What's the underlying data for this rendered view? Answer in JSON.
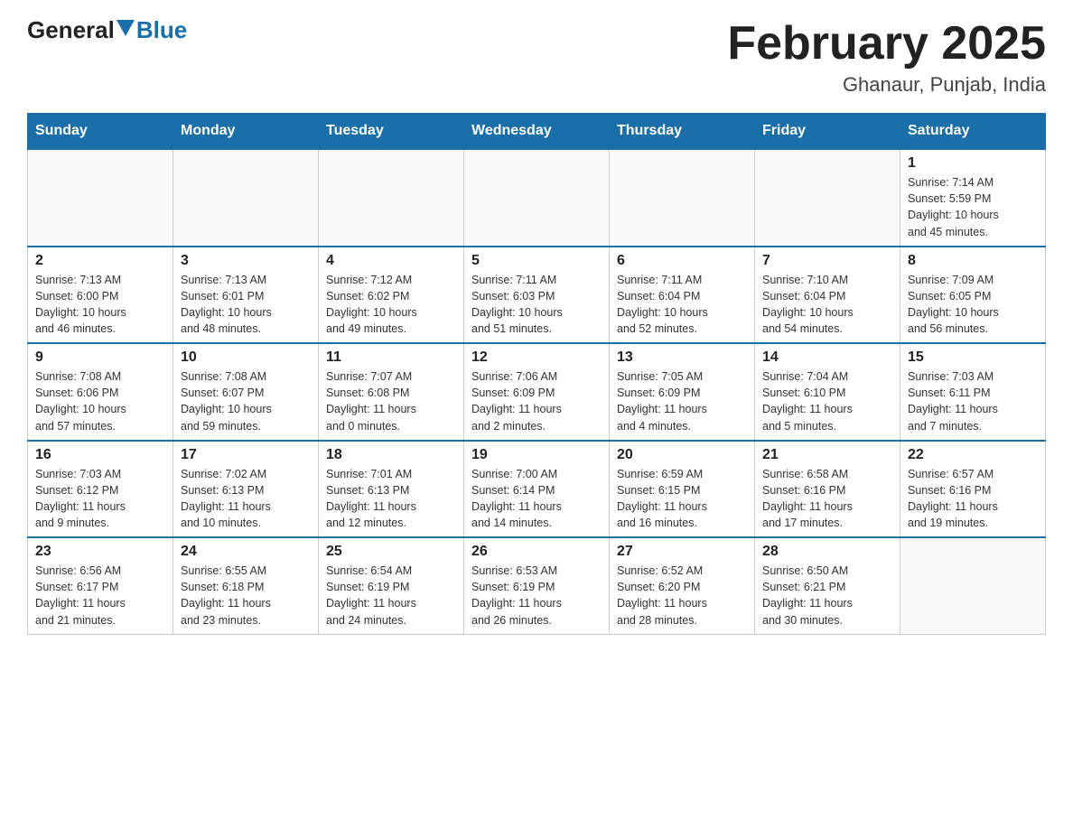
{
  "header": {
    "logo_general": "General",
    "logo_blue": "Blue",
    "month_title": "February 2025",
    "location": "Ghanaur, Punjab, India"
  },
  "days_of_week": [
    "Sunday",
    "Monday",
    "Tuesday",
    "Wednesday",
    "Thursday",
    "Friday",
    "Saturday"
  ],
  "weeks": [
    [
      {
        "day": "",
        "info": ""
      },
      {
        "day": "",
        "info": ""
      },
      {
        "day": "",
        "info": ""
      },
      {
        "day": "",
        "info": ""
      },
      {
        "day": "",
        "info": ""
      },
      {
        "day": "",
        "info": ""
      },
      {
        "day": "1",
        "info": "Sunrise: 7:14 AM\nSunset: 5:59 PM\nDaylight: 10 hours\nand 45 minutes."
      }
    ],
    [
      {
        "day": "2",
        "info": "Sunrise: 7:13 AM\nSunset: 6:00 PM\nDaylight: 10 hours\nand 46 minutes."
      },
      {
        "day": "3",
        "info": "Sunrise: 7:13 AM\nSunset: 6:01 PM\nDaylight: 10 hours\nand 48 minutes."
      },
      {
        "day": "4",
        "info": "Sunrise: 7:12 AM\nSunset: 6:02 PM\nDaylight: 10 hours\nand 49 minutes."
      },
      {
        "day": "5",
        "info": "Sunrise: 7:11 AM\nSunset: 6:03 PM\nDaylight: 10 hours\nand 51 minutes."
      },
      {
        "day": "6",
        "info": "Sunrise: 7:11 AM\nSunset: 6:04 PM\nDaylight: 10 hours\nand 52 minutes."
      },
      {
        "day": "7",
        "info": "Sunrise: 7:10 AM\nSunset: 6:04 PM\nDaylight: 10 hours\nand 54 minutes."
      },
      {
        "day": "8",
        "info": "Sunrise: 7:09 AM\nSunset: 6:05 PM\nDaylight: 10 hours\nand 56 minutes."
      }
    ],
    [
      {
        "day": "9",
        "info": "Sunrise: 7:08 AM\nSunset: 6:06 PM\nDaylight: 10 hours\nand 57 minutes."
      },
      {
        "day": "10",
        "info": "Sunrise: 7:08 AM\nSunset: 6:07 PM\nDaylight: 10 hours\nand 59 minutes."
      },
      {
        "day": "11",
        "info": "Sunrise: 7:07 AM\nSunset: 6:08 PM\nDaylight: 11 hours\nand 0 minutes."
      },
      {
        "day": "12",
        "info": "Sunrise: 7:06 AM\nSunset: 6:09 PM\nDaylight: 11 hours\nand 2 minutes."
      },
      {
        "day": "13",
        "info": "Sunrise: 7:05 AM\nSunset: 6:09 PM\nDaylight: 11 hours\nand 4 minutes."
      },
      {
        "day": "14",
        "info": "Sunrise: 7:04 AM\nSunset: 6:10 PM\nDaylight: 11 hours\nand 5 minutes."
      },
      {
        "day": "15",
        "info": "Sunrise: 7:03 AM\nSunset: 6:11 PM\nDaylight: 11 hours\nand 7 minutes."
      }
    ],
    [
      {
        "day": "16",
        "info": "Sunrise: 7:03 AM\nSunset: 6:12 PM\nDaylight: 11 hours\nand 9 minutes."
      },
      {
        "day": "17",
        "info": "Sunrise: 7:02 AM\nSunset: 6:13 PM\nDaylight: 11 hours\nand 10 minutes."
      },
      {
        "day": "18",
        "info": "Sunrise: 7:01 AM\nSunset: 6:13 PM\nDaylight: 11 hours\nand 12 minutes."
      },
      {
        "day": "19",
        "info": "Sunrise: 7:00 AM\nSunset: 6:14 PM\nDaylight: 11 hours\nand 14 minutes."
      },
      {
        "day": "20",
        "info": "Sunrise: 6:59 AM\nSunset: 6:15 PM\nDaylight: 11 hours\nand 16 minutes."
      },
      {
        "day": "21",
        "info": "Sunrise: 6:58 AM\nSunset: 6:16 PM\nDaylight: 11 hours\nand 17 minutes."
      },
      {
        "day": "22",
        "info": "Sunrise: 6:57 AM\nSunset: 6:16 PM\nDaylight: 11 hours\nand 19 minutes."
      }
    ],
    [
      {
        "day": "23",
        "info": "Sunrise: 6:56 AM\nSunset: 6:17 PM\nDaylight: 11 hours\nand 21 minutes."
      },
      {
        "day": "24",
        "info": "Sunrise: 6:55 AM\nSunset: 6:18 PM\nDaylight: 11 hours\nand 23 minutes."
      },
      {
        "day": "25",
        "info": "Sunrise: 6:54 AM\nSunset: 6:19 PM\nDaylight: 11 hours\nand 24 minutes."
      },
      {
        "day": "26",
        "info": "Sunrise: 6:53 AM\nSunset: 6:19 PM\nDaylight: 11 hours\nand 26 minutes."
      },
      {
        "day": "27",
        "info": "Sunrise: 6:52 AM\nSunset: 6:20 PM\nDaylight: 11 hours\nand 28 minutes."
      },
      {
        "day": "28",
        "info": "Sunrise: 6:50 AM\nSunset: 6:21 PM\nDaylight: 11 hours\nand 30 minutes."
      },
      {
        "day": "",
        "info": ""
      }
    ]
  ]
}
